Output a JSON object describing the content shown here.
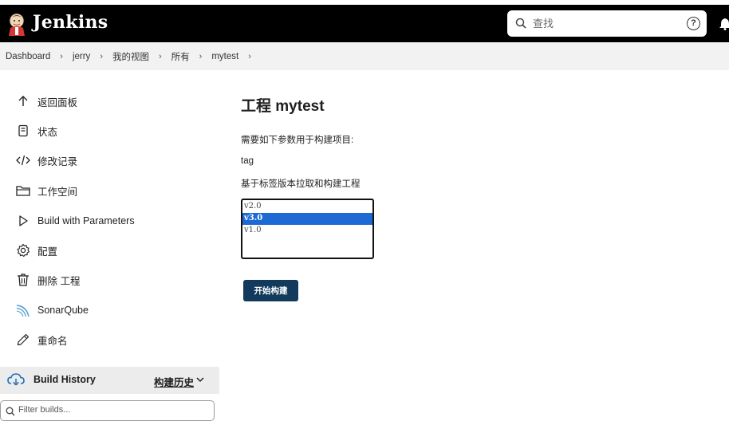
{
  "header": {
    "brand": "Jenkins",
    "search_placeholder": "查找",
    "help_glyph": "?"
  },
  "breadcrumb": [
    "Dashboard",
    "jerry",
    "我的视图",
    "所有",
    "mytest"
  ],
  "sidebar": {
    "items": [
      {
        "label": "返回面板",
        "icon": "arrow-up-icon"
      },
      {
        "label": "状态",
        "icon": "document-icon"
      },
      {
        "label": "修改记录",
        "icon": "code-icon"
      },
      {
        "label": "工作空间",
        "icon": "folder-icon"
      },
      {
        "label": "Build with Parameters",
        "icon": "play-icon"
      },
      {
        "label": "配置",
        "icon": "gear-icon"
      },
      {
        "label": "删除 工程",
        "icon": "trash-icon"
      },
      {
        "label": "SonarQube",
        "icon": "sonarqube-icon"
      },
      {
        "label": "重命名",
        "icon": "pencil-icon"
      }
    ]
  },
  "build_history": {
    "title": "Build History",
    "link": "构建历史",
    "filter_placeholder": "Filter builds..."
  },
  "main": {
    "title": "工程 mytest",
    "description": "需要如下参数用于构建项目:",
    "param_name": "tag",
    "param_description": "基于标签版本拉取和构建工程",
    "options": [
      "v2.0",
      "v3.0",
      "v1.0"
    ],
    "selected_option": "v3.0",
    "build_button": "开始构建"
  },
  "colors": {
    "topbar": "#000000",
    "selection": "#1e6ad4",
    "build_button": "#113a5c"
  }
}
